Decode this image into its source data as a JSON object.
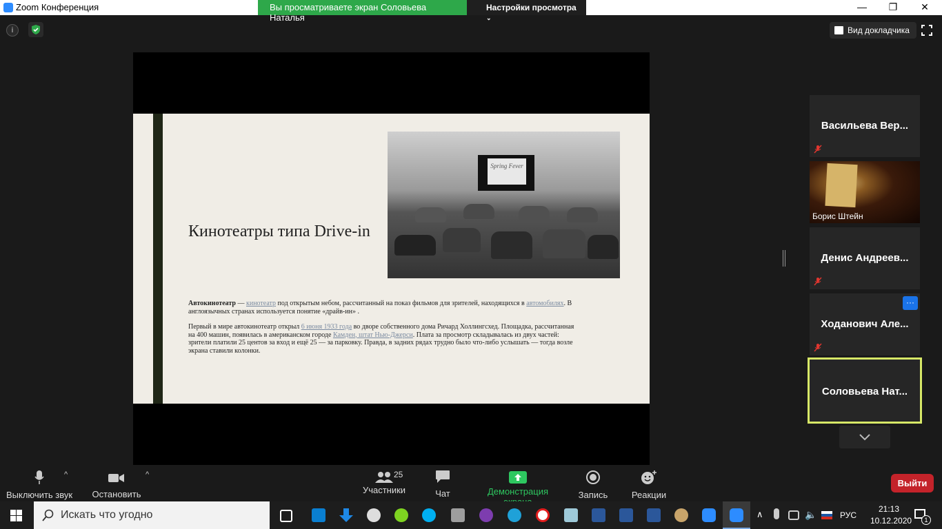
{
  "window": {
    "title": "Zoom Конференция",
    "minimize": "—",
    "maximize": "❐",
    "close": "✕"
  },
  "share_banner": {
    "status": "Вы просматриваете экран Соловьева Наталья",
    "view_options": "Настройки просмотра"
  },
  "topbar": {
    "info": "i",
    "speaker_view": "Вид докладчика"
  },
  "slide": {
    "heading": "Кинотеатры типа Drive-in",
    "photo_screen_text": "Spring Fever",
    "p1": {
      "bold": "Автокинотеатр",
      "t1": " — ",
      "link1": "кинотеатр",
      "t2": " под открытым небом, рассчитанный на показ фильмов для зрителей, находящихся в ",
      "link2": "автомобилях",
      "t3": ". В англоязычных странах используется понятие «драйв-ин» ."
    },
    "p2": {
      "t1": "Первый в мире автокинотеатр открыл ",
      "link1": "6 июня 1933 года",
      "t2": " во дворе собственного дома Ричард Холлингсхед. Площадка, рассчитанная на 400 машин, появилась в американском городе ",
      "link2": "Камден, штат Нью-Джерси",
      "t3": ". Плата за просмотр складывалась из двух частей: зрители платили 25 центов за вход и ещё 25 — за парковку. Правда, в задних рядах трудно было что-либо услышать — тогда возле экрана ставили колонки."
    }
  },
  "participants": [
    {
      "name": "Васильева  Вер...",
      "muted": true
    },
    {
      "name": "Борис Штейн",
      "muted": false,
      "video": true
    },
    {
      "name": "Денис  Андреев...",
      "muted": true
    },
    {
      "name": "Ходанович  Але...",
      "muted": true,
      "more": "···"
    },
    {
      "name": "Соловьева  Нат...",
      "muted": false,
      "active_speaker": true
    }
  ],
  "toolbar": {
    "mute": "Выключить звук",
    "stop_video": "Остановить видео",
    "participants": "Участники",
    "participants_count": "25",
    "chat": "Чат",
    "share_screen": "Демонстрация экрана",
    "record": "Запись",
    "reactions": "Реакции",
    "leave": "Выйти"
  },
  "taskbar": {
    "search_placeholder": "Искать что угодно",
    "language": "РУС",
    "time": "21:13",
    "date": "10.12.2020",
    "notifications": "1"
  },
  "colors": {
    "share_green": "#2ea84a",
    "leave_red": "#c4232a",
    "active_speaker_border": "#d7e867",
    "muted_red": "#e0362f"
  }
}
